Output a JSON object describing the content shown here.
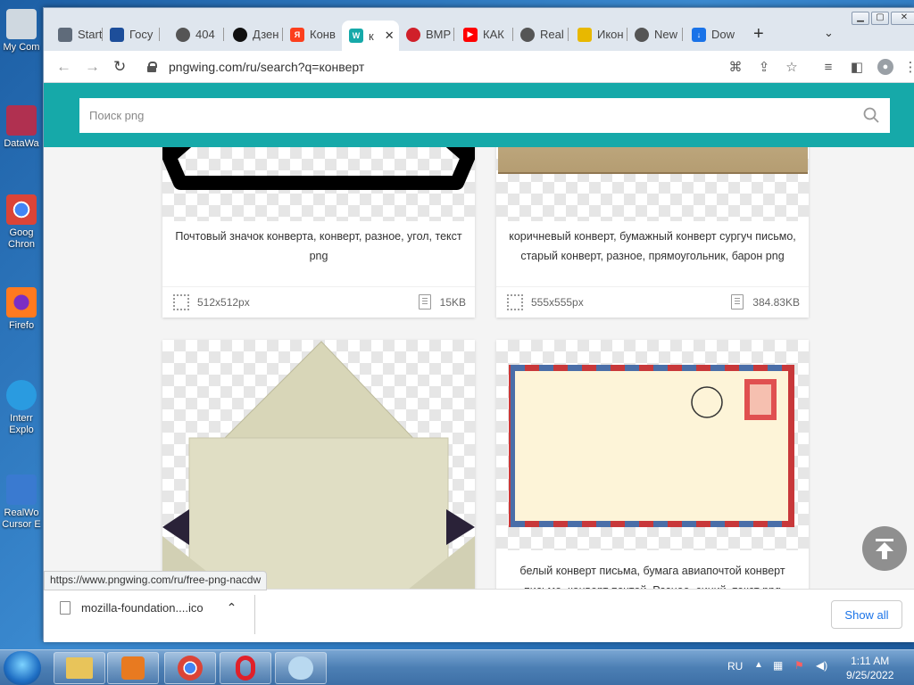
{
  "desktop": {
    "icons": [
      {
        "label": "My Com",
        "color": "#cfd8e0"
      },
      {
        "label": "DataWa",
        "color": "#b03050"
      },
      {
        "label": "Goog\nChron",
        "color": "#db4437"
      },
      {
        "label": "Firefo",
        "color": "#ff7a20"
      },
      {
        "label": "Interr\nExplo",
        "color": "#2a9be0"
      },
      {
        "label": "RealWo\nCursor E",
        "color": "#3a7ad0"
      }
    ]
  },
  "browser": {
    "tabs": [
      {
        "title": "Start",
        "favicon": "doc-icon",
        "color": "#5f6b7a"
      },
      {
        "title": "Госу",
        "favicon": "gosuslugi-icon",
        "color": "#1d4e9a"
      },
      {
        "title": "404",
        "favicon": "globe-icon",
        "color": "#555"
      },
      {
        "title": "Дзен",
        "favicon": "dzen-icon",
        "color": "#111"
      },
      {
        "title": "Конв",
        "favicon": "yandex-icon",
        "color": "#fc3f1d"
      },
      {
        "title": "к",
        "favicon": "pngwing-icon",
        "color": "#16a9a9",
        "active": true
      },
      {
        "title": "BMP",
        "favicon": "opera-icon",
        "color": "#d0202a"
      },
      {
        "title": "КАК",
        "favicon": "youtube-icon",
        "color": "#f00"
      },
      {
        "title": "Real",
        "favicon": "globe-icon",
        "color": "#555"
      },
      {
        "title": "Икон",
        "favicon": "image-icon",
        "color": "#e8b800"
      },
      {
        "title": "New",
        "favicon": "chrome-icon",
        "color": "#555"
      },
      {
        "title": "Dow",
        "favicon": "download-icon",
        "color": "#1a73e8"
      }
    ],
    "new_tab": "+",
    "url": "pngwing.com/ru/search?q=конверт"
  },
  "page": {
    "search_placeholder": "Поиск png",
    "cards": [
      {
        "caption": "Почтовый значок конверта, конверт, разное, угол, текст png",
        "dimensions": "512x512px",
        "filesize": "15KB"
      },
      {
        "caption": "коричневый конверт, бумажный конверт сургуч письмо, старый конверт, разное, прямоугольник, барон png",
        "dimensions": "555x555px",
        "filesize": "384.83KB"
      },
      {
        "caption": "",
        "dimensions": "",
        "filesize": ""
      },
      {
        "caption": "белый конверт письма, бумага авиапочтой конверт письмо, конверт почтой, Разное, синий, текст png",
        "dimensions": "",
        "filesize": ""
      }
    ],
    "status_url": "https://www.pngwing.com/ru/free-png-nacdw"
  },
  "downloads": {
    "filename": "mozilla-foundation....ico",
    "show_all": "Show all"
  },
  "taskbar": {
    "apps": [
      "explorer",
      "media-player",
      "chrome",
      "opera",
      "paint"
    ],
    "lang": "RU",
    "time": "1:11 AM",
    "date": "9/25/2022"
  },
  "colors": {
    "accent": "#16a9a9",
    "link": "#1a73e8"
  }
}
